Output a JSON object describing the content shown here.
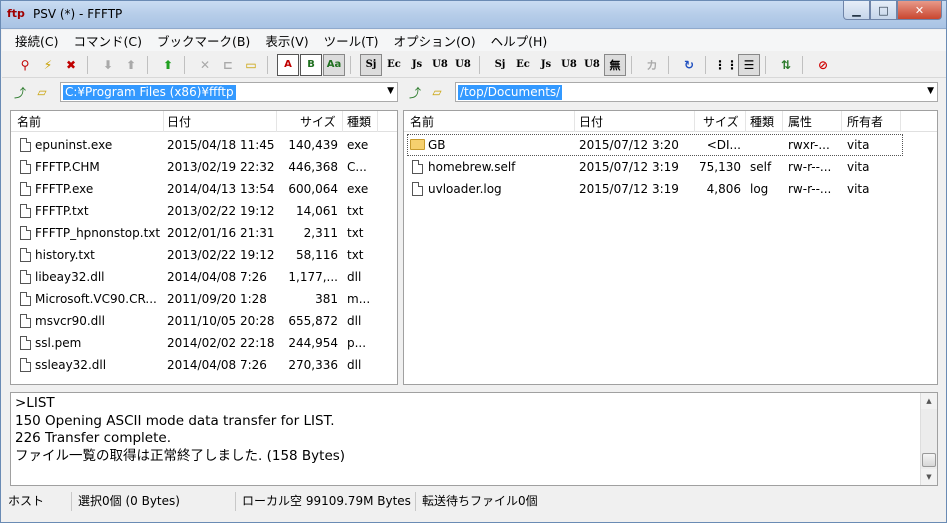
{
  "window": {
    "title": "PSV (*) - FFFTP",
    "app_icon": "ffftp-logo"
  },
  "menu": [
    "接続(C)",
    "コマンド(C)",
    "ブックマーク(B)",
    "表示(V)",
    "ツール(T)",
    "オプション(O)",
    "ヘルプ(H)"
  ],
  "toolbar": {
    "transfer_ascii": "A",
    "transfer_binary": "B",
    "transfer_auto": "Aa",
    "kanji_sjis": "Sj",
    "kanji_euc": "Ec",
    "kanji_jis": "Js",
    "kanji_utf8n": "U8",
    "kanji_utf8bom": "U8",
    "kanji_none": "無",
    "kana": "カ"
  },
  "local_path": "C:¥Program Files (x86)¥ffftp",
  "remote_path": "/top/Documents/",
  "local_headers": {
    "name": "名前",
    "date": "日付",
    "size": "サイズ",
    "type": "種類"
  },
  "remote_headers": {
    "name": "名前",
    "date": "日付",
    "size": "サイズ",
    "type": "種類",
    "attr": "属性",
    "owner": "所有者"
  },
  "local_files": [
    {
      "name": "epuninst.exe",
      "date": "2015/04/18 11:45",
      "size": "140,439",
      "type": "exe"
    },
    {
      "name": "FFFTP.CHM",
      "date": "2013/02/19 22:32",
      "size": "446,368",
      "type": "C..."
    },
    {
      "name": "FFFTP.exe",
      "date": "2014/04/13 13:54",
      "size": "600,064",
      "type": "exe"
    },
    {
      "name": "FFFTP.txt",
      "date": "2013/02/22 19:12",
      "size": "14,061",
      "type": "txt"
    },
    {
      "name": "FFFTP_hpnonstop.txt",
      "date": "2012/01/16 21:31",
      "size": "2,311",
      "type": "txt"
    },
    {
      "name": "history.txt",
      "date": "2013/02/22 19:12",
      "size": "58,116",
      "type": "txt"
    },
    {
      "name": "libeay32.dll",
      "date": "2014/04/08  7:26",
      "size": "1,177,...",
      "type": "dll"
    },
    {
      "name": "Microsoft.VC90.CR...",
      "date": "2011/09/20  1:28",
      "size": "381",
      "type": "m..."
    },
    {
      "name": "msvcr90.dll",
      "date": "2011/10/05 20:28",
      "size": "655,872",
      "type": "dll"
    },
    {
      "name": "ssl.pem",
      "date": "2014/02/02 22:18",
      "size": "244,954",
      "type": "p..."
    },
    {
      "name": "ssleay32.dll",
      "date": "2014/04/08  7:26",
      "size": "270,336",
      "type": "dll"
    }
  ],
  "remote_files": [
    {
      "name": "GB",
      "kind": "folder",
      "date": "2015/07/12  3:20",
      "size": "<DI...",
      "type": "",
      "attr": "rwxr-...",
      "owner": "vita"
    },
    {
      "name": "homebrew.self",
      "kind": "file",
      "date": "2015/07/12  3:19",
      "size": "75,130",
      "type": "self",
      "attr": "rw-r--...",
      "owner": "vita"
    },
    {
      "name": "uvloader.log",
      "kind": "file",
      "date": "2015/07/12  3:19",
      "size": "4,806",
      "type": "log",
      "attr": "rw-r--...",
      "owner": "vita"
    }
  ],
  "log_lines": [
    ">LIST",
    "150 Opening ASCII mode data transfer for LIST.",
    "226 Transfer complete.",
    "ファイル一覧の取得は正常終了しました. (158 Bytes)"
  ],
  "status": {
    "host": "ホスト",
    "selection": "選択0個 (0 Bytes)",
    "local_free": "ローカル空 99109.79M Bytes",
    "queue": "転送待ちファイル0個"
  }
}
